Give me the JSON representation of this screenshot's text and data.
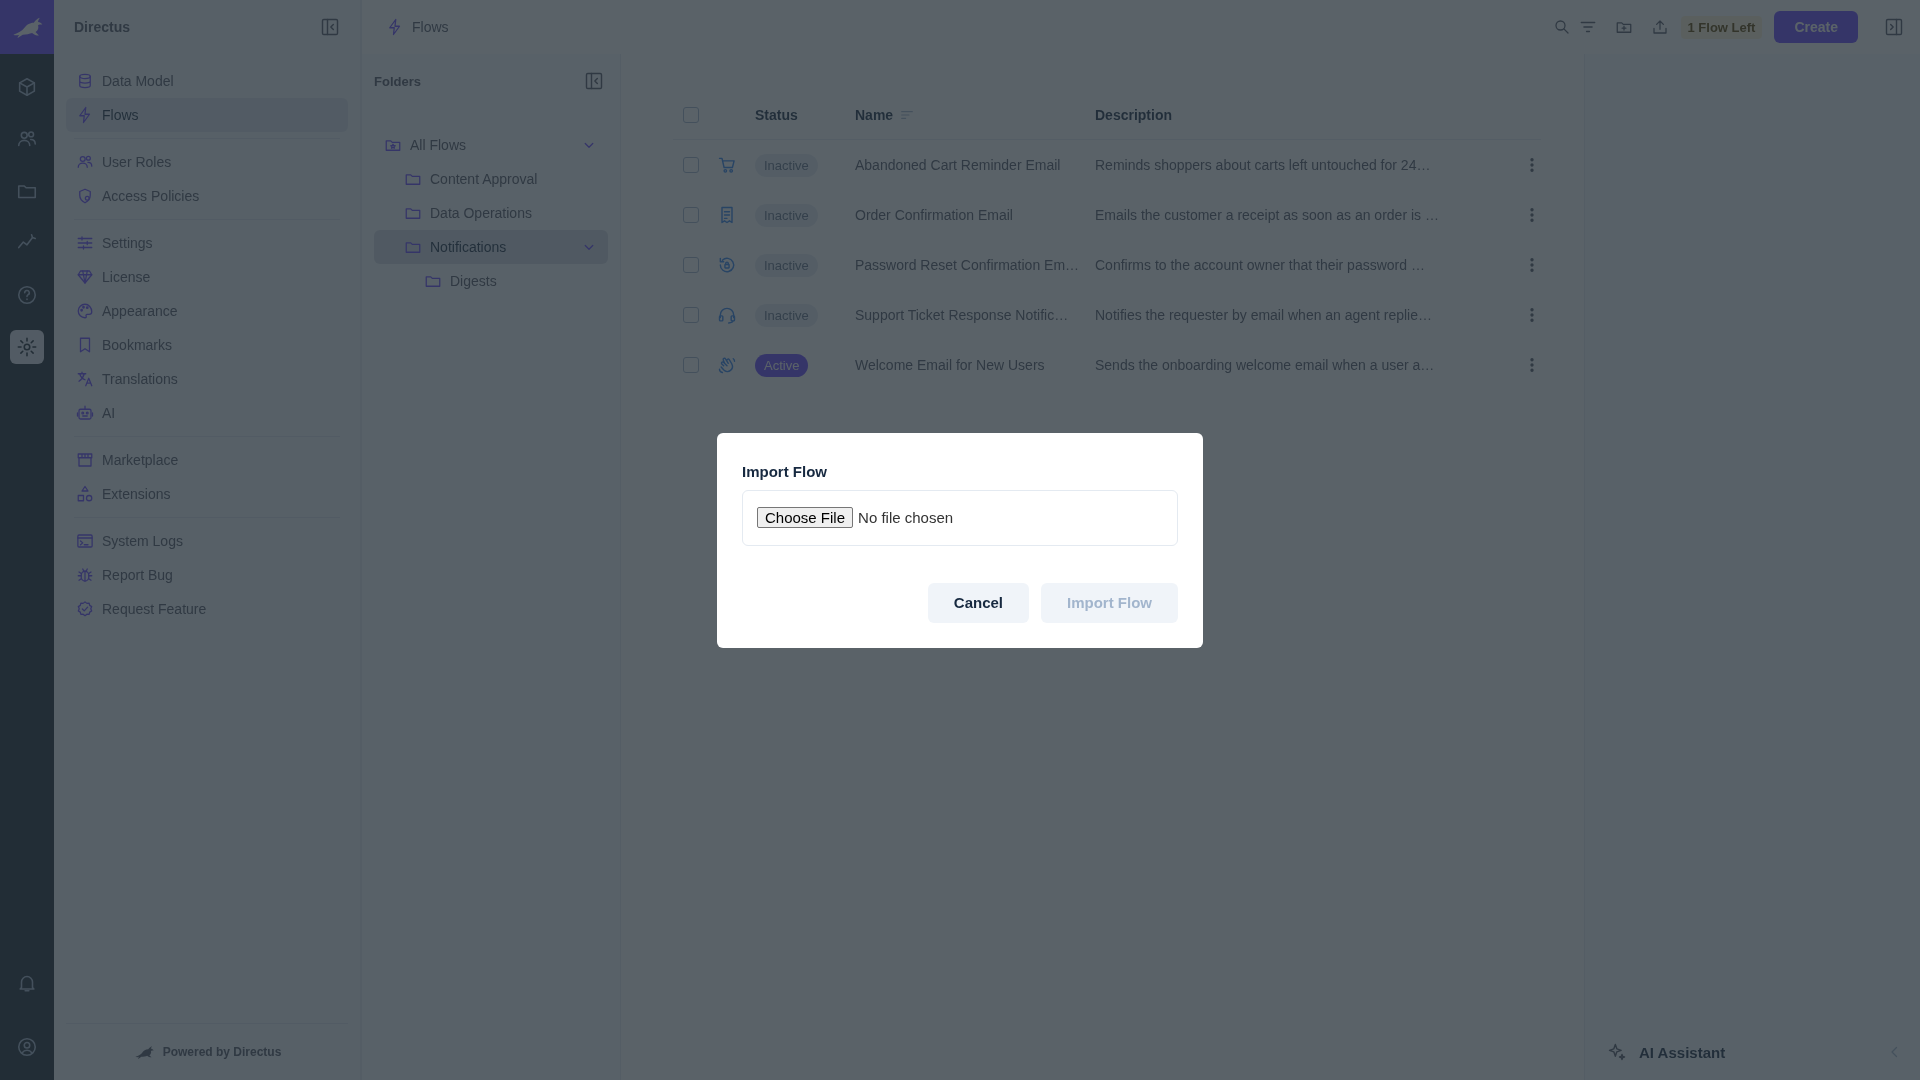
{
  "nav_rail": {
    "modules": [
      {
        "selected": false
      },
      {
        "selected": false
      },
      {
        "selected": false
      },
      {
        "selected": false
      },
      {
        "selected": false
      },
      {
        "selected": true
      }
    ],
    "bottom": [
      {
        "selected": false
      },
      {
        "selected": false
      }
    ]
  },
  "sidebar": {
    "title": "Directus",
    "groups": [
      [
        {
          "label": "Data Model",
          "selected": false
        },
        {
          "label": "Flows",
          "selected": true
        }
      ],
      [
        {
          "label": "User Roles",
          "selected": false
        },
        {
          "label": "Access Policies",
          "selected": false
        }
      ],
      [
        {
          "label": "Settings",
          "selected": false
        },
        {
          "label": "License",
          "selected": false
        },
        {
          "label": "Appearance",
          "selected": false
        },
        {
          "label": "Bookmarks",
          "selected": false
        },
        {
          "label": "Translations",
          "selected": false
        },
        {
          "label": "AI",
          "selected": false
        }
      ],
      [
        {
          "label": "Marketplace",
          "selected": false
        },
        {
          "label": "Extensions",
          "selected": false
        }
      ],
      [
        {
          "label": "System Logs",
          "selected": false
        },
        {
          "label": "Report Bug",
          "selected": false
        },
        {
          "label": "Request Feature",
          "selected": false
        }
      ]
    ],
    "footer": "Powered by Directus"
  },
  "header": {
    "title": "Flows",
    "badge": "1 Flow Left",
    "create_button": "Create"
  },
  "folders": {
    "title": "Folders",
    "tree": [
      {
        "label": "All Flows",
        "expanded": true,
        "selected": false,
        "children": [
          {
            "label": "Content Approval",
            "selected": false
          },
          {
            "label": "Data Operations",
            "selected": false
          },
          {
            "label": "Notifications",
            "expanded": true,
            "selected": true,
            "children": [
              {
                "label": "Digests",
                "selected": false
              }
            ]
          }
        ]
      }
    ]
  },
  "table": {
    "columns": [
      "Status",
      "Name",
      "Description"
    ],
    "all_checked": false,
    "rows": [
      {
        "checked": false,
        "status": {
          "text": "Inactive",
          "kind": "inactive"
        },
        "name": "Abandoned Cart Reminder Email",
        "description": "Reminds shoppers about carts left untouched for 24…"
      },
      {
        "checked": false,
        "status": {
          "text": "Inactive",
          "kind": "inactive"
        },
        "name": "Order Confirmation Email",
        "description": "Emails the customer a receipt as soon as an order is …"
      },
      {
        "checked": false,
        "status": {
          "text": "Inactive",
          "kind": "inactive"
        },
        "name": "Password Reset Confirmation Em…",
        "description": "Confirms to the account owner that their password …"
      },
      {
        "checked": false,
        "status": {
          "text": "Inactive",
          "kind": "inactive"
        },
        "name": "Support Ticket Response Notific…",
        "description": "Notifies the requester by email when an agent replie…"
      },
      {
        "checked": false,
        "status": {
          "text": "Active",
          "kind": "active"
        },
        "name": "Welcome Email for New Users",
        "description": "Sends the onboarding welcome email when a user a…"
      }
    ]
  },
  "aside": {
    "title": "AI Assistant"
  },
  "modal": {
    "title": "Import Flow",
    "file_button": "Choose File",
    "file_status": "No file chosen",
    "buttons": [
      {
        "label": "Cancel",
        "disabled": false
      },
      {
        "label": "Import Flow",
        "disabled": true
      }
    ]
  }
}
